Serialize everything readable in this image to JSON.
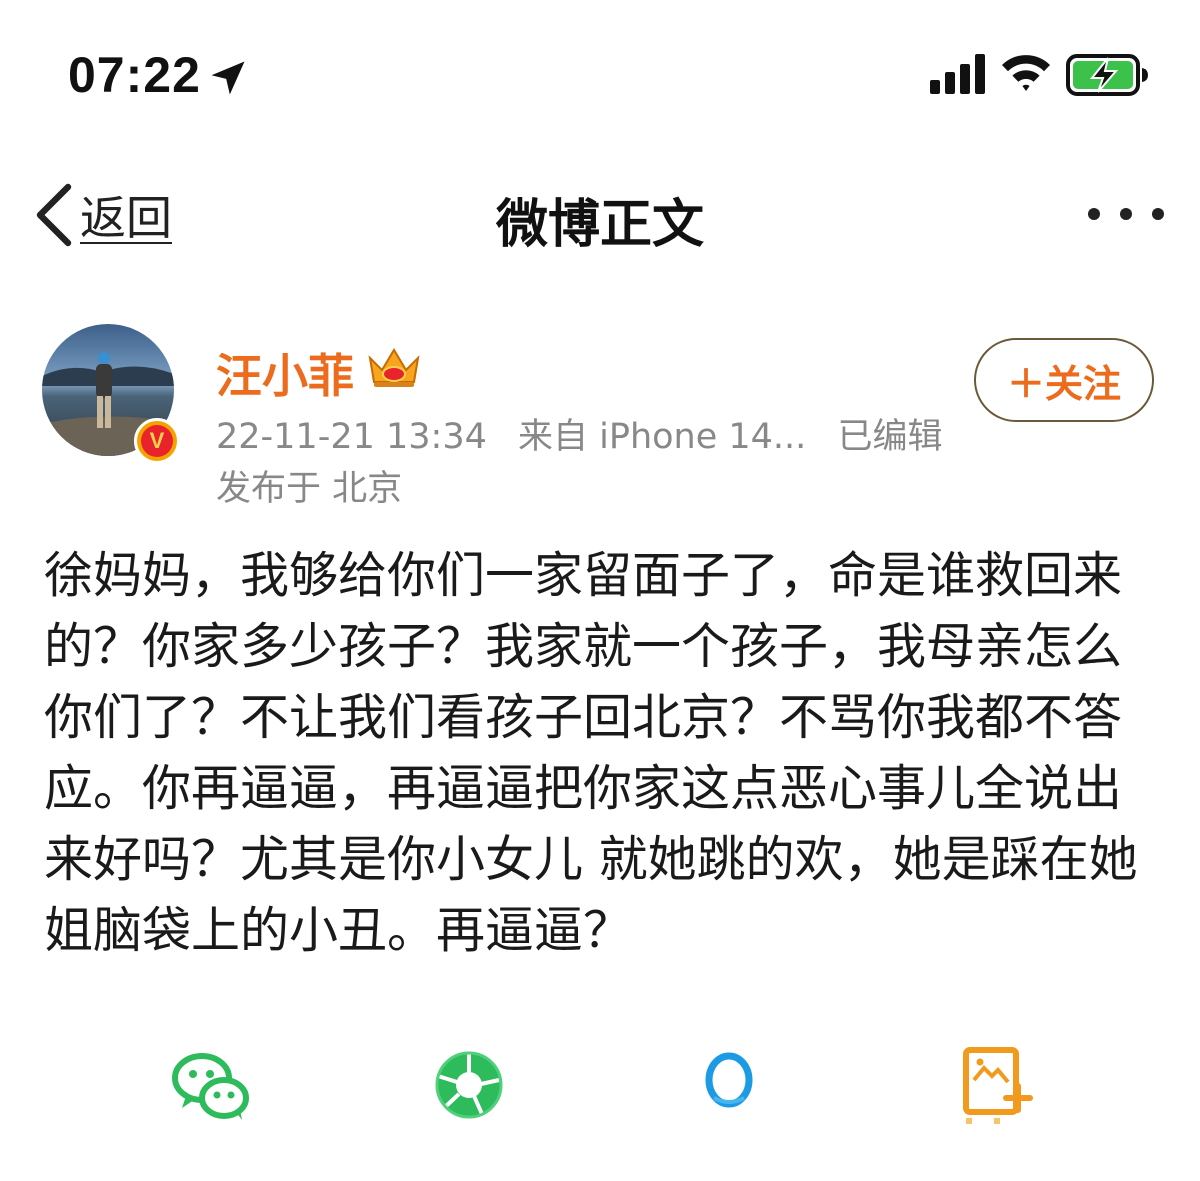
{
  "status_bar": {
    "time": "07:22",
    "icons": [
      "location-arrow-icon",
      "cellular-signal-icon",
      "wifi-icon",
      "battery-charging-icon"
    ]
  },
  "nav": {
    "back_label": "返回",
    "title": "微博正文",
    "more_icon": "more-dots-icon"
  },
  "post": {
    "author": "汪小菲",
    "timestamp": "22-11-21 13:34",
    "source": "来自 iPhone 14...",
    "edited": "已编辑",
    "location": "发布于 北京",
    "follow_label": "＋关注",
    "body": "徐妈妈，我够给你们一家留面子了，命是谁救回来的？你家多少孩子？我家就一个孩子，我母亲怎么你们了？不让我们看孩子回北京？不骂你我都不答应。你再逼逼，再逼逼把你家这点恶心事儿全说出来好吗？尤其是你小女儿 就她跳的欢，她是踩在她姐脑袋上的小丑。再逼逼？"
  },
  "share": {
    "items": [
      "wechat-icon",
      "moments-icon",
      "weibo-circle-icon",
      "poster-image-icon"
    ]
  },
  "colors": {
    "username": "#ec6b1d",
    "meta": "#888888",
    "wechat_green": "#2dbb5c",
    "weibo_blue": "#1c9be4",
    "poster_orange": "#f29a1e"
  }
}
